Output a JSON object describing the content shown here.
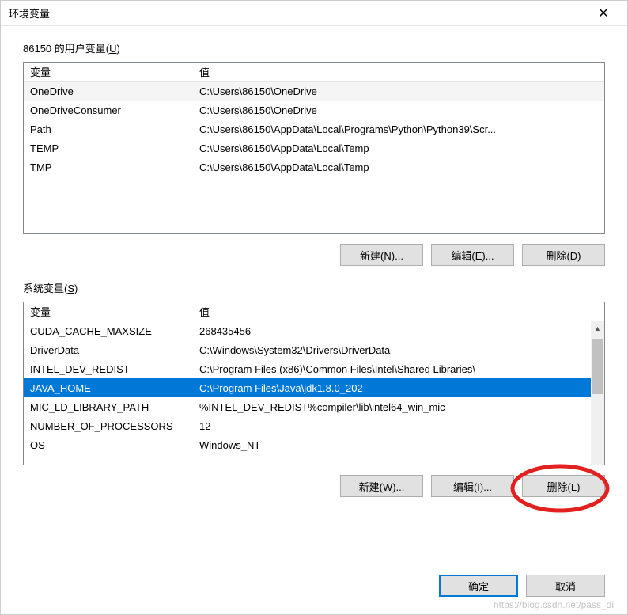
{
  "titlebar": {
    "title": "环境变量"
  },
  "userSection": {
    "label": "86150 的用户变量(",
    "labelU": "U",
    "labelEnd": ")",
    "headers": {
      "var": "变量",
      "val": "值"
    },
    "rows": [
      {
        "var": "OneDrive",
        "val": "C:\\Users\\86150\\OneDrive"
      },
      {
        "var": "OneDriveConsumer",
        "val": "C:\\Users\\86150\\OneDrive"
      },
      {
        "var": "Path",
        "val": "C:\\Users\\86150\\AppData\\Local\\Programs\\Python\\Python39\\Scr..."
      },
      {
        "var": "TEMP",
        "val": "C:\\Users\\86150\\AppData\\Local\\Temp"
      },
      {
        "var": "TMP",
        "val": "C:\\Users\\86150\\AppData\\Local\\Temp"
      }
    ],
    "buttons": {
      "new": "新建(N)...",
      "edit": "编辑(E)...",
      "delete": "删除(D)"
    }
  },
  "sysSection": {
    "label": "系统变量(",
    "labelU": "S",
    "labelEnd": ")",
    "headers": {
      "var": "变量",
      "val": "值"
    },
    "rows": [
      {
        "var": "CUDA_CACHE_MAXSIZE",
        "val": "268435456"
      },
      {
        "var": "DriverData",
        "val": "C:\\Windows\\System32\\Drivers\\DriverData"
      },
      {
        "var": "INTEL_DEV_REDIST",
        "val": "C:\\Program Files (x86)\\Common Files\\Intel\\Shared Libraries\\"
      },
      {
        "var": "JAVA_HOME",
        "val": "C:\\Program Files\\Java\\jdk1.8.0_202",
        "selected": true
      },
      {
        "var": "MIC_LD_LIBRARY_PATH",
        "val": "%INTEL_DEV_REDIST%compiler\\lib\\intel64_win_mic"
      },
      {
        "var": "NUMBER_OF_PROCESSORS",
        "val": "12"
      },
      {
        "var": "OS",
        "val": "Windows_NT"
      }
    ],
    "buttons": {
      "new": "新建(W)...",
      "edit": "编辑(I)...",
      "delete": "删除(L)"
    }
  },
  "footer": {
    "ok": "确定",
    "cancel": "取消"
  },
  "watermark": "https://blog.csdn.net/pass_di"
}
